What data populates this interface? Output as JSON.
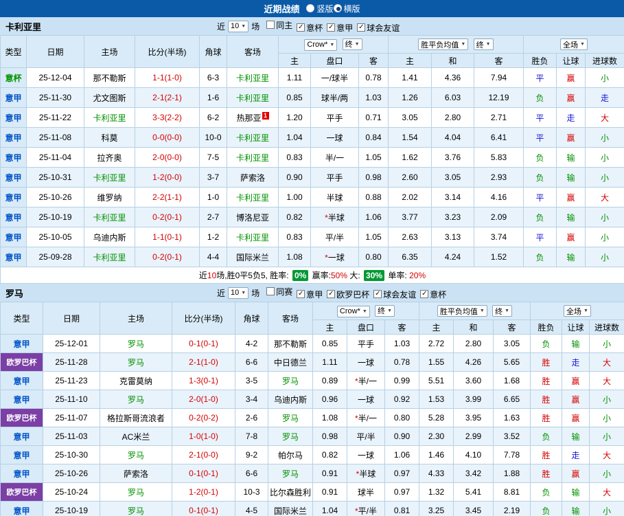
{
  "colors": {
    "topbar_blue": "#0a5aa8",
    "table_header_bg": "#d9ebf8",
    "row_alt_bg": "#e9f3fb",
    "europa_purple": "#7b3fa5",
    "serie_a_blue": "#0053c8",
    "cup_green": "#009100",
    "team_green": "#009100",
    "score_red": "#d40000",
    "win_red": "#d40000",
    "draw_blue": "#1414d4",
    "loss_green": "#009100",
    "pct_badge_green": "#009933"
  },
  "topbar": {
    "title": "近期战绩",
    "layout_options": [
      {
        "label": "竖版",
        "selected": false
      },
      {
        "label": "横版",
        "selected": true
      }
    ]
  },
  "sections": [
    {
      "team": "卡利亚里",
      "filters": {
        "near": "近",
        "count": "10",
        "unit": "场",
        "checkboxes": [
          {
            "label": "同主",
            "checked": false
          },
          {
            "label": "意杯",
            "checked": true
          },
          {
            "label": "意甲",
            "checked": true
          },
          {
            "label": "球会友谊",
            "checked": true
          }
        ]
      },
      "header": {
        "cols": [
          "类型",
          "日期",
          "主场",
          "比分(半场)",
          "角球",
          "客场"
        ],
        "odds_group": {
          "bookmaker": "Crow*",
          "final": "终",
          "cols": [
            "主",
            "盘口",
            "客"
          ]
        },
        "avg_group": {
          "label": "胜平负均值",
          "final": "终",
          "cols": [
            "主",
            "和",
            "客"
          ]
        },
        "result_group": {
          "scope": "全场",
          "cols": [
            "胜负",
            "让球",
            "进球数"
          ]
        }
      },
      "rows": [
        {
          "type": "意杯",
          "date": "25-12-04",
          "home": "那不勒斯",
          "score": "1-1(1-0)",
          "corner": "6-3",
          "away": "卡利亚里",
          "odds_home": "1.11",
          "handicap": "一/球半",
          "odds_away": "0.78",
          "avg_home": "1.41",
          "avg_draw": "4.36",
          "avg_away": "7.94",
          "result": "平",
          "handicap_result": "赢",
          "goals_result": "小"
        },
        {
          "type": "意甲",
          "date": "25-11-30",
          "home": "尤文图斯",
          "score": "2-1(2-1)",
          "corner": "1-6",
          "away": "卡利亚里",
          "odds_home": "0.85",
          "handicap": "球半/两",
          "odds_away": "1.03",
          "avg_home": "1.26",
          "avg_draw": "6.03",
          "avg_away": "12.19",
          "result": "负",
          "handicap_result": "赢",
          "goals_result": "走"
        },
        {
          "type": "意甲",
          "date": "25-11-22",
          "home": "卡利亚里",
          "score": "3-3(2-2)",
          "corner": "6-2",
          "away": "热那亚",
          "away_badge": "1",
          "odds_home": "1.20",
          "handicap": "平手",
          "odds_away": "0.71",
          "avg_home": "3.05",
          "avg_draw": "2.80",
          "avg_away": "2.71",
          "result": "平",
          "handicap_result": "走",
          "goals_result": "大"
        },
        {
          "type": "意甲",
          "date": "25-11-08",
          "home": "科莫",
          "score": "0-0(0-0)",
          "corner": "10-0",
          "away": "卡利亚里",
          "odds_home": "1.04",
          "handicap": "一球",
          "odds_away": "0.84",
          "avg_home": "1.54",
          "avg_draw": "4.04",
          "avg_away": "6.41",
          "result": "平",
          "handicap_result": "赢",
          "goals_result": "小"
        },
        {
          "type": "意甲",
          "date": "25-11-04",
          "home": "拉齐奥",
          "score": "2-0(0-0)",
          "corner": "7-5",
          "away": "卡利亚里",
          "odds_home": "0.83",
          "handicap": "半/一",
          "odds_away": "1.05",
          "avg_home": "1.62",
          "avg_draw": "3.76",
          "avg_away": "5.83",
          "result": "负",
          "handicap_result": "输",
          "goals_result": "小"
        },
        {
          "type": "意甲",
          "date": "25-10-31",
          "home": "卡利亚里",
          "score": "1-2(0-0)",
          "corner": "3-7",
          "away": "萨索洛",
          "odds_home": "0.90",
          "handicap": "平手",
          "odds_away": "0.98",
          "avg_home": "2.60",
          "avg_draw": "3.05",
          "avg_away": "2.93",
          "result": "负",
          "handicap_result": "输",
          "goals_result": "小"
        },
        {
          "type": "意甲",
          "date": "25-10-26",
          "home": "维罗纳",
          "score": "2-2(1-1)",
          "corner": "1-0",
          "away": "卡利亚里",
          "odds_home": "1.00",
          "handicap": "半球",
          "odds_away": "0.88",
          "avg_home": "2.02",
          "avg_draw": "3.14",
          "avg_away": "4.16",
          "result": "平",
          "handicap_result": "赢",
          "goals_result": "大"
        },
        {
          "type": "意甲",
          "date": "25-10-19",
          "home": "卡利亚里",
          "score": "0-2(0-1)",
          "corner": "2-7",
          "away": "博洛尼亚",
          "odds_home": "0.82",
          "handicap": "*半球",
          "odds_away": "1.06",
          "avg_home": "3.77",
          "avg_draw": "3.23",
          "avg_away": "2.09",
          "result": "负",
          "handicap_result": "输",
          "goals_result": "小"
        },
        {
          "type": "意甲",
          "date": "25-10-05",
          "home": "乌迪内斯",
          "score": "1-1(0-1)",
          "corner": "1-2",
          "away": "卡利亚里",
          "odds_home": "0.83",
          "handicap": "平/半",
          "odds_away": "1.05",
          "avg_home": "2.63",
          "avg_draw": "3.13",
          "avg_away": "3.74",
          "result": "平",
          "handicap_result": "赢",
          "goals_result": "小"
        },
        {
          "type": "意甲",
          "date": "25-09-28",
          "home": "卡利亚里",
          "score": "0-2(0-1)",
          "corner": "4-4",
          "away": "国际米兰",
          "odds_home": "1.08",
          "handicap": "*一球",
          "odds_away": "0.80",
          "avg_home": "6.35",
          "avg_draw": "4.24",
          "avg_away": "1.52",
          "result": "负",
          "handicap_result": "输",
          "goals_result": "小"
        }
      ],
      "summary": [
        {
          "text": "近",
          "style": ""
        },
        {
          "text": "10",
          "style": "red"
        },
        {
          "text": "场,胜0平5负5, 胜率: ",
          "style": ""
        },
        {
          "text": "0%",
          "style": "pct"
        },
        {
          "text": " 赢率:",
          "style": ""
        },
        {
          "text": "50%",
          "style": "red"
        },
        {
          "text": " 大: ",
          "style": ""
        },
        {
          "text": "30%",
          "style": "pct"
        },
        {
          "text": " 单率: ",
          "style": ""
        },
        {
          "text": "20%",
          "style": "red"
        }
      ]
    },
    {
      "team": "罗马",
      "filters": {
        "near": "近",
        "count": "10",
        "unit": "场",
        "checkboxes": [
          {
            "label": "同赛",
            "checked": false
          },
          {
            "label": "意甲",
            "checked": true
          },
          {
            "label": "欧罗巴杯",
            "checked": true
          },
          {
            "label": "球会友谊",
            "checked": true
          },
          {
            "label": "意杯",
            "checked": true
          }
        ]
      },
      "header": {
        "cols": [
          "类型",
          "日期",
          "主场",
          "比分(半场)",
          "角球",
          "客场"
        ],
        "odds_group": {
          "bookmaker": "Crow*",
          "final": "终",
          "cols": [
            "主",
            "盘口",
            "客"
          ]
        },
        "avg_group": {
          "label": "胜平负均值",
          "final": "终",
          "cols": [
            "主",
            "和",
            "客"
          ]
        },
        "result_group": {
          "scope": "全场",
          "cols": [
            "胜负",
            "让球",
            "进球数"
          ]
        }
      },
      "rows": [
        {
          "type": "意甲",
          "date": "25-12-01",
          "home": "罗马",
          "score": "0-1(0-1)",
          "corner": "4-2",
          "away": "那不勒斯",
          "odds_home": "0.85",
          "handicap": "平手",
          "odds_away": "1.03",
          "avg_home": "2.72",
          "avg_draw": "2.80",
          "avg_away": "3.05",
          "result": "负",
          "handicap_result": "输",
          "goals_result": "小"
        },
        {
          "type": "欧罗巴杯",
          "date": "25-11-28",
          "home": "罗马",
          "score": "2-1(1-0)",
          "corner": "6-6",
          "away": "中日德兰",
          "odds_home": "1.11",
          "handicap": "一球",
          "odds_away": "0.78",
          "avg_home": "1.55",
          "avg_draw": "4.26",
          "avg_away": "5.65",
          "result": "胜",
          "handicap_result": "走",
          "goals_result": "大"
        },
        {
          "type": "意甲",
          "date": "25-11-23",
          "home": "克雷莫纳",
          "score": "1-3(0-1)",
          "corner": "3-5",
          "away": "罗马",
          "odds_home": "0.89",
          "handicap": "*半/一",
          "odds_away": "0.99",
          "avg_home": "5.51",
          "avg_draw": "3.60",
          "avg_away": "1.68",
          "result": "胜",
          "handicap_result": "赢",
          "goals_result": "大"
        },
        {
          "type": "意甲",
          "date": "25-11-10",
          "home": "罗马",
          "score": "2-0(1-0)",
          "corner": "3-4",
          "away": "乌迪内斯",
          "odds_home": "0.96",
          "handicap": "一球",
          "odds_away": "0.92",
          "avg_home": "1.53",
          "avg_draw": "3.99",
          "avg_away": "6.65",
          "result": "胜",
          "handicap_result": "赢",
          "goals_result": "小"
        },
        {
          "type": "欧罗巴杯",
          "date": "25-11-07",
          "home": "格拉斯哥流浪者",
          "score": "0-2(0-2)",
          "corner": "2-6",
          "away": "罗马",
          "odds_home": "1.08",
          "handicap": "*半/一",
          "odds_away": "0.80",
          "avg_home": "5.28",
          "avg_draw": "3.95",
          "avg_away": "1.63",
          "result": "胜",
          "handicap_result": "赢",
          "goals_result": "小"
        },
        {
          "type": "意甲",
          "date": "25-11-03",
          "home": "AC米兰",
          "score": "1-0(1-0)",
          "corner": "7-8",
          "away": "罗马",
          "odds_home": "0.98",
          "handicap": "平/半",
          "odds_away": "0.90",
          "avg_home": "2.30",
          "avg_draw": "2.99",
          "avg_away": "3.52",
          "result": "负",
          "handicap_result": "输",
          "goals_result": "小"
        },
        {
          "type": "意甲",
          "date": "25-10-30",
          "home": "罗马",
          "score": "2-1(0-0)",
          "corner": "9-2",
          "away": "帕尔马",
          "odds_home": "0.82",
          "handicap": "一球",
          "odds_away": "1.06",
          "avg_home": "1.46",
          "avg_draw": "4.10",
          "avg_away": "7.78",
          "result": "胜",
          "handicap_result": "走",
          "goals_result": "大"
        },
        {
          "type": "意甲",
          "date": "25-10-26",
          "home": "萨索洛",
          "score": "0-1(0-1)",
          "corner": "6-6",
          "away": "罗马",
          "odds_home": "0.91",
          "handicap": "*半球",
          "odds_away": "0.97",
          "avg_home": "4.33",
          "avg_draw": "3.42",
          "avg_away": "1.88",
          "result": "胜",
          "handicap_result": "赢",
          "goals_result": "小"
        },
        {
          "type": "欧罗巴杯",
          "date": "25-10-24",
          "home": "罗马",
          "score": "1-2(0-1)",
          "corner": "10-3",
          "away": "比尔森胜利",
          "odds_home": "0.91",
          "handicap": "球半",
          "odds_away": "0.97",
          "avg_home": "1.32",
          "avg_draw": "5.41",
          "avg_away": "8.81",
          "result": "负",
          "handicap_result": "输",
          "goals_result": "大"
        },
        {
          "type": "意甲",
          "date": "25-10-19",
          "home": "罗马",
          "score": "0-1(0-1)",
          "corner": "4-5",
          "away": "国际米兰",
          "odds_home": "1.04",
          "handicap": "*平/半",
          "odds_away": "0.81",
          "avg_home": "3.25",
          "avg_draw": "3.45",
          "avg_away": "2.19",
          "result": "负",
          "handicap_result": "输",
          "goals_result": "小"
        }
      ]
    }
  ]
}
